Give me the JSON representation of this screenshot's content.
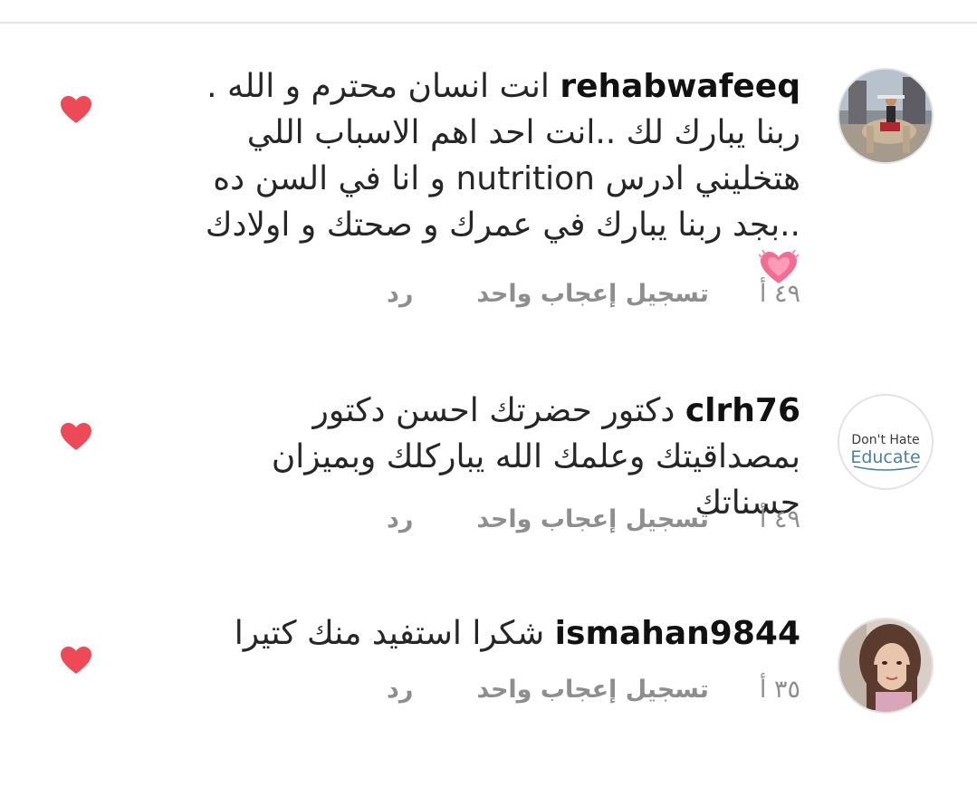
{
  "comments": [
    {
      "username": "rehabwafeeq",
      "text": " انت انسان محترم و الله . ربنا يبارك لك ..انت احد اهم الاسباب اللي هتخليني ادرس nutrition و انا في السن ده ..بجد ربنا يبارك في عمرك و صحتك و اولادك",
      "emoji": "growing-heart-emoji",
      "time": "٤٩ أ",
      "likes": "تسجيل إعجاب واحد",
      "reply": "رد",
      "avatar": "photo-person-with-camel"
    },
    {
      "username": "clrh76",
      "text": " دكتور حضرتك احسن دكتور بمصداقيتك وعلمك الله يباركلك وبميزان حسناتك",
      "time": "٤٩ أ",
      "likes": "تسجيل إعجاب واحد",
      "reply": "رد",
      "avatar_line1": "Don't Hate",
      "avatar_line2": "Educate"
    },
    {
      "username": "ismahan9844",
      "text": " شكرا استفيد منك كتيرا",
      "time": "٣٥ أ",
      "likes": "تسجيل إعجاب واحد",
      "reply": "رد",
      "avatar": "photo-woman-portrait"
    }
  ],
  "colors": {
    "heart": "#ed4956",
    "meta_text": "#8e8e8e",
    "body_text": "#262626"
  }
}
